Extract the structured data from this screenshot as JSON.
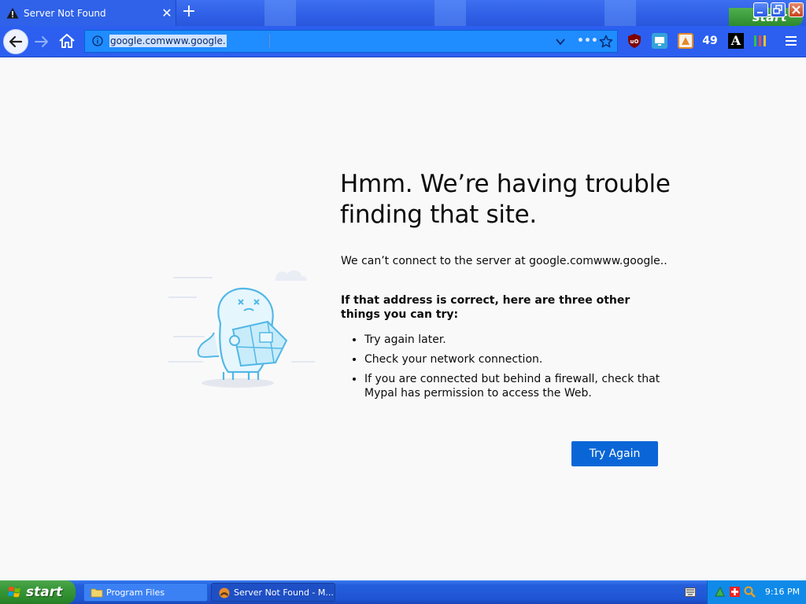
{
  "browser": {
    "tab": {
      "title": "Server Not Found",
      "close_glyph": "✕"
    },
    "new_tab_glyph": "+",
    "ghost_start_label": "start",
    "urlbar": {
      "value": "google.comwww.google.",
      "more_glyph": "•••"
    },
    "extensions": {
      "count_badge": "49",
      "a_label": "A"
    },
    "accent_color": "#2c5ff0"
  },
  "error_page": {
    "title": "Hmm. We’re having trouble finding that site.",
    "description": "We can’t connect to the server at google.comwww.google..",
    "suggest_heading": "If that address is correct, here are three other things you can try:",
    "suggestions": [
      "Try again later.",
      "Check your network connection.",
      "If you are connected but behind a firewall, check that Mypal has permission to access the Web."
    ],
    "try_again_label": "Try Again",
    "button_color": "#0a66d6"
  },
  "taskbar": {
    "start_label": "start",
    "tasks": [
      {
        "label": "Program Files"
      },
      {
        "label": "Server Not Found - M..."
      }
    ],
    "clock": "9:16 PM"
  }
}
